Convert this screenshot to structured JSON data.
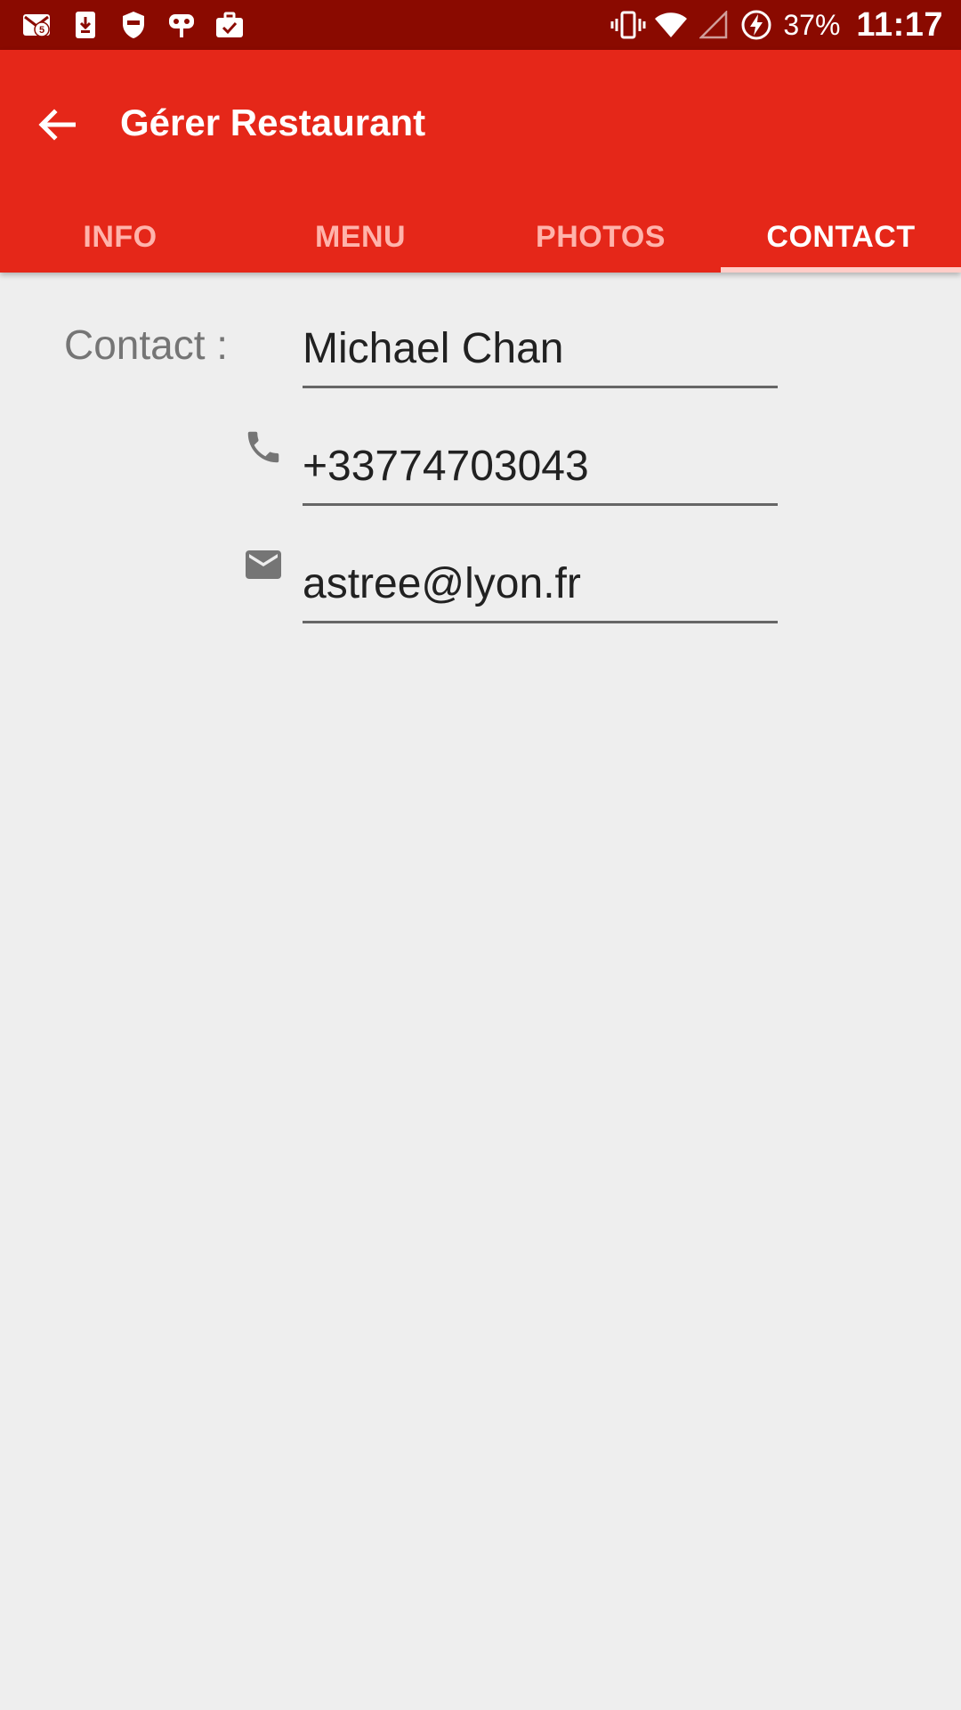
{
  "status_bar": {
    "icons_left": [
      "gmail-icon",
      "download-icon",
      "shield-icon",
      "cyanogen-icon",
      "briefcase-check-icon"
    ],
    "gmail_badge": "5",
    "icons_right": [
      "vibrate-icon",
      "wifi-icon",
      "signal-icon",
      "battery-charging-icon"
    ],
    "battery": "37%",
    "time": "11:17"
  },
  "app_bar": {
    "title": "Gérer Restaurant",
    "back_icon": "arrow-back-icon",
    "background": "#e52719"
  },
  "tabs": [
    {
      "label": "INFO",
      "active": false
    },
    {
      "label": "MENU",
      "active": false
    },
    {
      "label": "PHOTOS",
      "active": false
    },
    {
      "label": "CONTACT",
      "active": true
    }
  ],
  "contact": {
    "label": "Contact :",
    "name": "Michael Chan",
    "phone": "+33774703043",
    "email": "astree@lyon.fr",
    "phone_icon": "phone-icon",
    "email_icon": "mail-icon"
  }
}
